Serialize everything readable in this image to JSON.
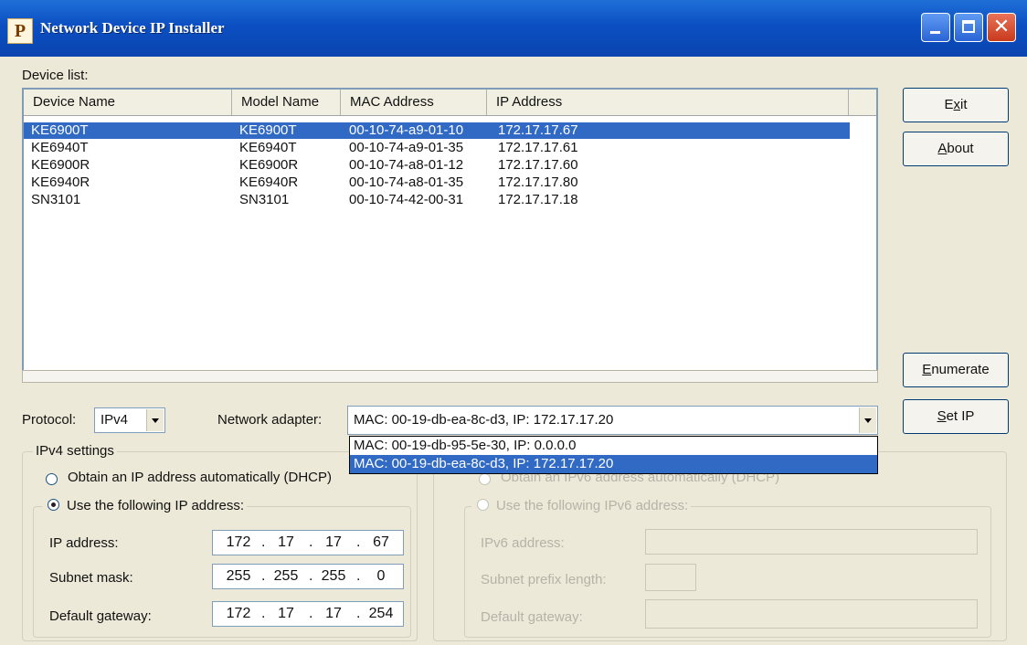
{
  "window": {
    "title": "Network Device IP Installer",
    "icon_letter": "P"
  },
  "device_list": {
    "label": "Device list:",
    "columns": [
      "Device Name",
      "Model Name",
      "MAC Address",
      "IP Address"
    ],
    "rows": [
      {
        "device": "KE6900T",
        "model": "KE6900T",
        "mac": "00-10-74-a9-01-10",
        "ip": "172.17.17.67",
        "selected": true
      },
      {
        "device": "KE6940T",
        "model": "KE6940T",
        "mac": "00-10-74-a9-01-35",
        "ip": "172.17.17.61",
        "selected": false
      },
      {
        "device": "KE6900R",
        "model": "KE6900R",
        "mac": "00-10-74-a8-01-12",
        "ip": "172.17.17.60",
        "selected": false
      },
      {
        "device": "KE6940R",
        "model": "KE6940R",
        "mac": "00-10-74-a8-01-35",
        "ip": "172.17.17.80",
        "selected": false
      },
      {
        "device": "SN3101",
        "model": "SN3101",
        "mac": "00-10-74-42-00-31",
        "ip": "172.17.17.18",
        "selected": false
      }
    ]
  },
  "buttons": {
    "exit": {
      "pre": "E",
      "ul": "x",
      "post": "it"
    },
    "about": {
      "pre": "",
      "ul": "A",
      "post": "bout"
    },
    "enumerate": {
      "pre": "",
      "ul": "E",
      "post": "numerate"
    },
    "set_ip": {
      "pre": "",
      "ul": "S",
      "post": "et IP"
    }
  },
  "protocol": {
    "label": "Protocol:",
    "value": "IPv4"
  },
  "network_adapter": {
    "label": "Network adapter:",
    "value": "MAC: 00-19-db-ea-8c-d3,  IP: 172.17.17.20",
    "options": [
      {
        "text": "MAC: 00-19-db-95-5e-30,  IP: 0.0.0.0",
        "selected": false
      },
      {
        "text": "MAC: 00-19-db-ea-8c-d3,  IP: 172.17.17.20",
        "selected": true
      }
    ]
  },
  "ipv4": {
    "group_title": "IPv4 settings",
    "dhcp_label": "Obtain an IP address automatically (DHCP)",
    "static_label": "Use the following IP address:",
    "ip_label": "IP address:",
    "ip": [
      "172",
      "17",
      "17",
      "67"
    ],
    "mask_label": "Subnet mask:",
    "mask": [
      "255",
      "255",
      "255",
      "0"
    ],
    "gateway_label": "Default gateway:",
    "gateway": [
      "172",
      "17",
      "17",
      "254"
    ]
  },
  "ipv6": {
    "dhcp_label": "Obtain an IPv6 address automatically (DHCP)",
    "static_label": "Use the following IPv6 address:",
    "ip_label": "IPv6 address:",
    "prefix_label": "Subnet prefix length:",
    "gateway_label": "Default gateway:"
  }
}
